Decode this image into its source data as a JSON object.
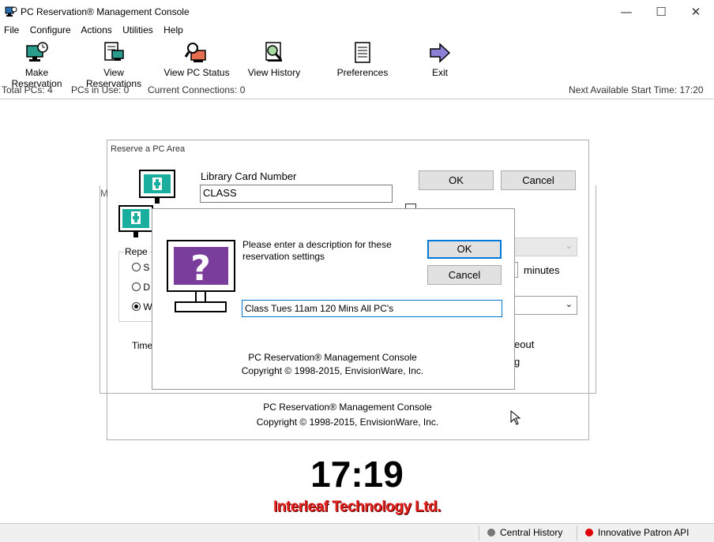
{
  "window": {
    "title": "PC Reservation® Management Console",
    "min": "—",
    "max": "☐",
    "close": "✕"
  },
  "menu": [
    "File",
    "Configure",
    "Actions",
    "Utilities",
    "Help"
  ],
  "toolbar": [
    {
      "label": "Make Reservation",
      "icon": "computer-clock-icon"
    },
    {
      "label": "View Reservations",
      "icon": "document-computer-icon"
    },
    {
      "label": "View PC Status",
      "icon": "magnifier-computer-icon"
    },
    {
      "label": "View History",
      "icon": "history-document-icon"
    },
    {
      "label": "Preferences",
      "icon": "list-document-icon"
    },
    {
      "label": "Exit",
      "icon": "exit-arrow-icon"
    }
  ],
  "status": {
    "total_pcs": "Total PCs: 4",
    "pcs_in_use": "PCs in Use: 0",
    "connections": "Current Connections: 0",
    "next_available": "Next Available Start Time: 17:20"
  },
  "reserve_area": {
    "title": "Reserve a PC Area",
    "card_label": "Library Card Number",
    "card_value": "CLASS",
    "ok": "OK",
    "cancel": "Cancel",
    "partial_check": "D",
    "repeat_label": "Repe",
    "radio_s": "S",
    "radio_d": "D",
    "radio_w": "W",
    "time_label": "Time",
    "minutes": "minutes",
    "eout": "eout",
    "g": "g",
    "footer_line1": "PC Reservation® Management Console",
    "footer_line2": "Copyright © 1998-2015, EnvisionWare, Inc."
  },
  "dialog": {
    "prompt": "Please enter a description for these reservation settings",
    "ok": "OK",
    "cancel": "Cancel",
    "description": "Class Tues 11am 120 Mins All PC's",
    "footer_line1": "PC Reservation® Management Console",
    "footer_line2": "Copyright © 1998-2015, EnvisionWare, Inc."
  },
  "clock": "17:19",
  "brand": "Interleaf Technology Ltd.",
  "statusbar": {
    "central_history": "Central History",
    "patron_api": "Innovative Patron API",
    "central_color": "#777777",
    "api_color": "#e00000"
  }
}
